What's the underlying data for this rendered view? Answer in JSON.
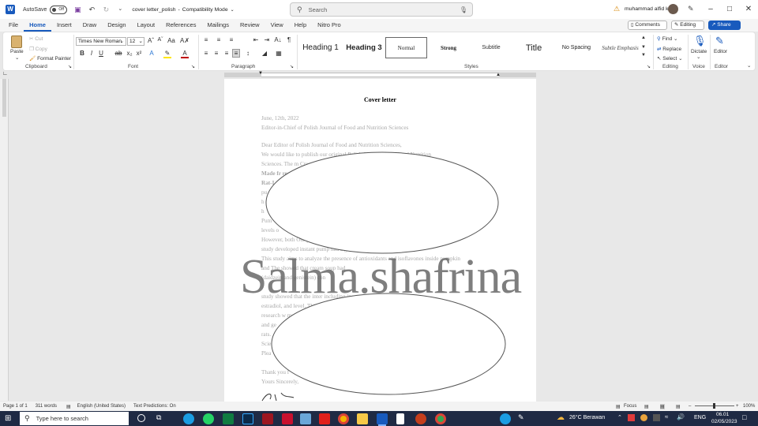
{
  "titlebar": {
    "autosave_label": "AutoSave",
    "autosave_state": "Off",
    "doc_title": "cover letter_polish",
    "mode": "Compatibility Mode",
    "search_placeholder": "Search",
    "user_name": "muhammad alfid k"
  },
  "tabs": [
    "File",
    "Home",
    "Insert",
    "Draw",
    "Design",
    "Layout",
    "References",
    "Mailings",
    "Review",
    "View",
    "Help",
    "Nitro Pro"
  ],
  "active_tab": "Home",
  "top_right": {
    "comments": "Comments",
    "editing": "Editing",
    "share": "Share"
  },
  "clipboard": {
    "paste": "Paste",
    "cut": "Cut",
    "copy": "Copy",
    "format_painter": "Format Painter",
    "label": "Clipboard"
  },
  "font": {
    "family": "Times New Roman",
    "size": "12",
    "label": "Font"
  },
  "paragraph": {
    "label": "Paragraph"
  },
  "styles": {
    "items": [
      "Heading 1",
      "Heading 3",
      "Normal",
      "Strong",
      "Subtitle",
      "Title",
      "No Spacing",
      "Subtle Emphasis"
    ],
    "label": "Styles"
  },
  "editing": {
    "find": "Find",
    "replace": "Replace",
    "select": "Select",
    "label": "Editing"
  },
  "voice": {
    "dictate": "Dictate",
    "label": "Voice"
  },
  "editor_group": {
    "editor": "Editor",
    "label": "Editor"
  },
  "document": {
    "heading": "Cover letter",
    "date": "June, 12th, 2022",
    "recipient": "Editor-in-Chief of Polish Journal of Food and Nutrition Sciences",
    "salutation": "Dear Editor of Polish Journal of Food and Nutrition Sciences,",
    "body_lines": [
      "We would like to publish our original                          Polish Journal of Food and Nutrition",
      "Sciences. The m                                                          Cream Soup",
      "Made fr                                                                            rectomy",
      "Rat-I",
      "pu",
      "h",
      "h",
      "Pum",
      "levels o",
      "However, both                                                                          Our previous",
      "study developed instant pump                                   had a good acceptance rate.",
      "This study aims to analyze the presence of antioxidants and isoflavones inside pumpkin",
      "and                   The        showed    that      cream   soup   had",
      "                 (daidzein and genistein) con",
      "",
      "study showed that the inter                               including increase serum",
      "estradiol, and                                                                         level. This",
      "research w                                                                                   model",
      "and ge",
      "rats.",
      "Scie",
      "Plea",
      "",
      "Thank you f",
      "Yours Sincerely,"
    ],
    "watermark": "Salma.shafrina"
  },
  "statusbar": {
    "page": "Page 1 of 1",
    "words": "311 words",
    "language": "English (United States)",
    "predictions": "Text Predictions: On",
    "focus": "Focus",
    "zoom": "100%"
  },
  "taskbar": {
    "search_placeholder": "Type here to search",
    "weather": "26°C  Berawan",
    "lang": "ENG",
    "time": "06.01",
    "date": "02/05/2023"
  },
  "colors": {
    "accent": "#185abd",
    "taskbar": "#1f2a44"
  }
}
